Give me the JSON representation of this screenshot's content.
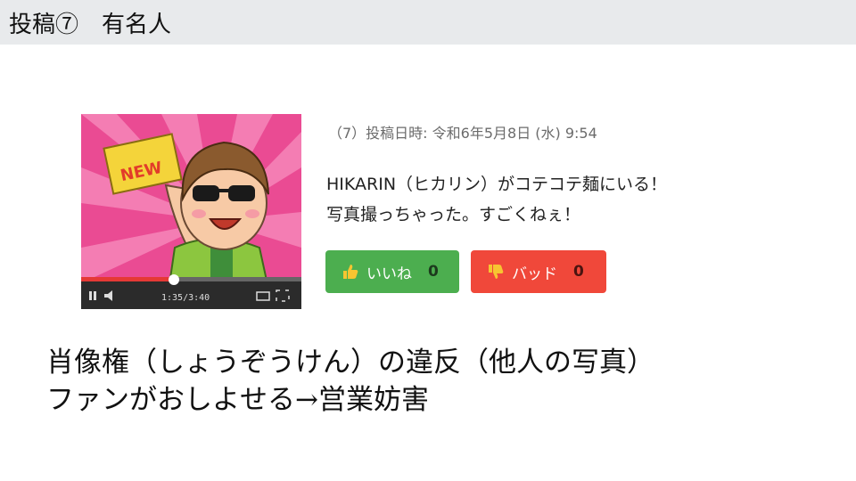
{
  "slide": {
    "title": "投稿⑦　有名人"
  },
  "post": {
    "meta": "（7）投稿日時: 令和6年5月8日 (水) 9:54",
    "line1": "HIKARIN（ヒカリン）がコテコテ麺にいる！",
    "line2": "写真撮っちゃった。すごくねぇ！",
    "thumbnail": {
      "badge_text": "NEW",
      "time_text": "1:35/3:40",
      "progress": 0.42
    }
  },
  "buttons": {
    "like": {
      "label": "いいね",
      "count": "0",
      "icon": "thumbs-up-icon",
      "color": "#4cae4f"
    },
    "bad": {
      "label": "バッド",
      "count": "0",
      "icon": "thumbs-down-icon",
      "color": "#f0483a"
    }
  },
  "caption": {
    "line1": "肖像権（しょうぞうけん）の違反（他人の写真）",
    "line2": "ファンがおしよせる→営業妨害"
  }
}
